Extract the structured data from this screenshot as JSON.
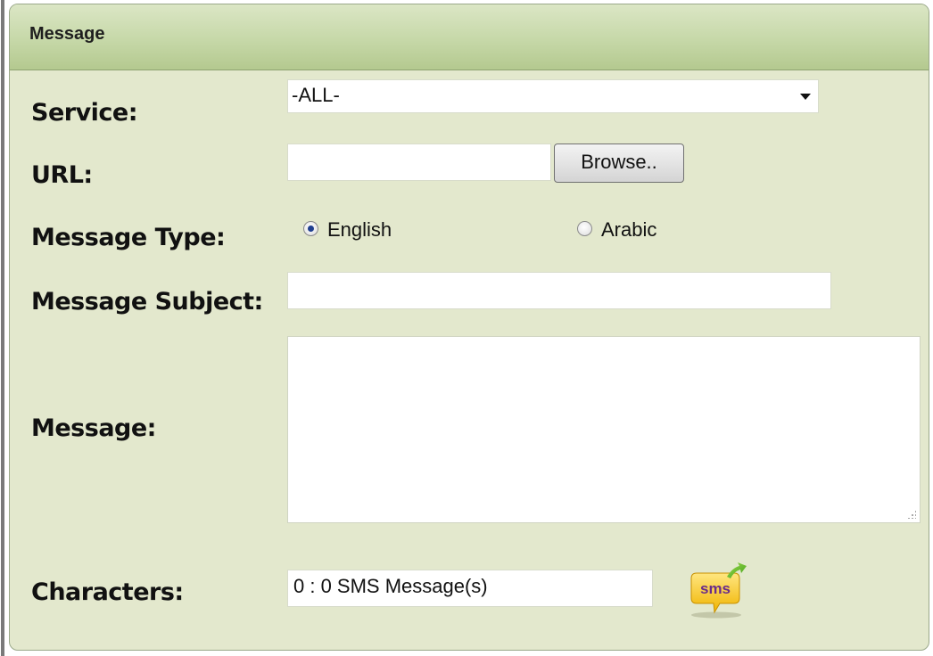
{
  "panel": {
    "title": "Message"
  },
  "fields": {
    "service_label": "Service:",
    "service_value": "-ALL-",
    "url_label": "URL:",
    "url_value": "",
    "browse_label": "Browse..",
    "message_type_label": "Message Type:",
    "radio_english": "English",
    "radio_arabic": "Arabic",
    "selected_type": "English",
    "subject_label": "Message Subject:",
    "subject_value": "",
    "message_label": "Message:",
    "message_value": "",
    "characters_label": "Characters:",
    "characters_value": "0 : 0 SMS Message(s)",
    "sms_icon_text": "sms"
  },
  "icons": {
    "select_arrow": "chevron-down-icon",
    "sms": "sms-icon"
  },
  "colors": {
    "panel_bg": "#e3e8cd",
    "header_bg": "#c6d8a8",
    "radio_selected": "#1f3f8f"
  }
}
